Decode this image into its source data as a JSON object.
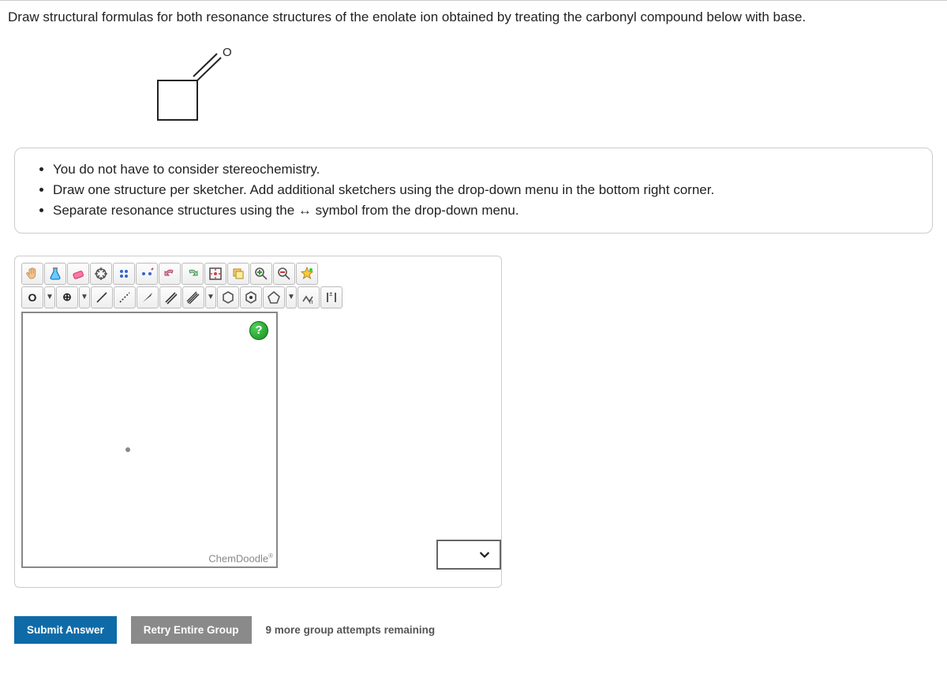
{
  "question": "Draw structural formulas for both resonance structures of the enolate ion obtained by treating the carbonyl compound below with base.",
  "molecule_oxygen_label": "O",
  "hints": [
    "You do not have to consider stereochemistry.",
    "Draw one structure per sketcher. Add additional sketchers using the drop-down menu in the bottom right corner.",
    "Separate resonance structures using the ↔ symbol from the drop-down menu."
  ],
  "toolbar": {
    "row1": [
      {
        "name": "hand-icon",
        "glyph": "hand"
      },
      {
        "name": "flask-icon",
        "glyph": "flask"
      },
      {
        "name": "eraser-icon",
        "glyph": "eraser"
      },
      {
        "name": "move-icon",
        "glyph": "move"
      },
      {
        "name": "lone-pair-icon",
        "glyph": "lonepair"
      },
      {
        "name": "radical-icon",
        "glyph": "radical"
      },
      {
        "name": "undo-icon",
        "glyph": "undo"
      },
      {
        "name": "redo-icon",
        "glyph": "redo"
      },
      {
        "name": "center-icon",
        "glyph": "center"
      },
      {
        "name": "copy-icon",
        "glyph": "copy"
      },
      {
        "name": "zoom-in-icon",
        "glyph": "zoomin"
      },
      {
        "name": "zoom-out-icon",
        "glyph": "zoomout"
      },
      {
        "name": "star-tool-icon",
        "glyph": "star"
      }
    ],
    "row2": [
      {
        "name": "element-oxygen-button",
        "text": "O",
        "dd": true
      },
      {
        "name": "add-charge-button",
        "text": "⊕",
        "dd": true
      },
      {
        "name": "single-bond-icon",
        "glyph": "sbond"
      },
      {
        "name": "recessed-bond-icon",
        "glyph": "rbond"
      },
      {
        "name": "wedge-bond-icon",
        "glyph": "wbond"
      },
      {
        "name": "double-bond-icon",
        "glyph": "dbond"
      },
      {
        "name": "triple-bond-icon",
        "glyph": "tbond",
        "dd": true
      },
      {
        "name": "cyclohexane-icon",
        "glyph": "hex"
      },
      {
        "name": "cyclohexane-alt-icon",
        "glyph": "hexd"
      },
      {
        "name": "cyclopentane-icon",
        "glyph": "pent",
        "dd": true
      },
      {
        "name": "chain-tool-icon",
        "glyph": "chain"
      },
      {
        "name": "bracket-charge-icon",
        "glyph": "bracket"
      }
    ]
  },
  "help_label": "?",
  "canvas_brand": "ChemDoodle",
  "canvas_brand_mark": "®",
  "actions": {
    "submit": "Submit Answer",
    "retry": "Retry Entire Group",
    "attempts": "9 more group attempts remaining"
  }
}
